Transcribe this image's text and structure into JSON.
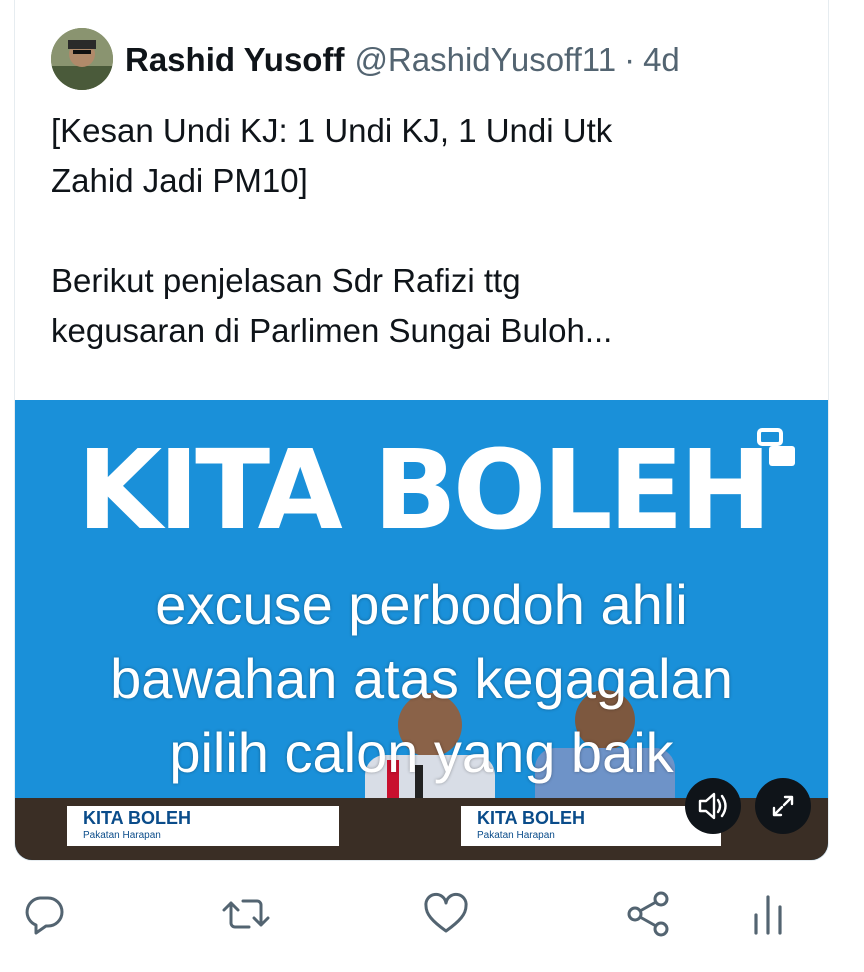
{
  "tweet": {
    "author_name": "Rashid Yusoff",
    "handle": "@RashidYusoff11",
    "separator": "·",
    "time": "4d",
    "text_lines": [
      "[Kesan Undi KJ: 1 Undi KJ, 1 Undi Utk",
      "Zahid Jadi PM10]",
      "Berikut penjelasan Sdr Rafizi ttg",
      "kegusaran di Parlimen Sungai Buloh..."
    ]
  },
  "media": {
    "type": "video",
    "background_text": "KITA BOLEH",
    "caption_lines": [
      "excuse perbodoh ahli",
      "bawahan atas kegagalan",
      "pilih calon yang baik"
    ],
    "banner_title": "KITA BOLEH",
    "banner_subtitle": "Pakatan Harapan",
    "controls": [
      "sound-icon",
      "expand-icon"
    ],
    "accent_color": "#1a90d9"
  },
  "actions": [
    "reply-icon",
    "retweet-icon",
    "like-icon",
    "share-icon",
    "analytics-icon"
  ],
  "colors": {
    "text": "#0f1419",
    "secondary": "#536471",
    "border": "#e6ecf0",
    "icon": "#536471"
  }
}
